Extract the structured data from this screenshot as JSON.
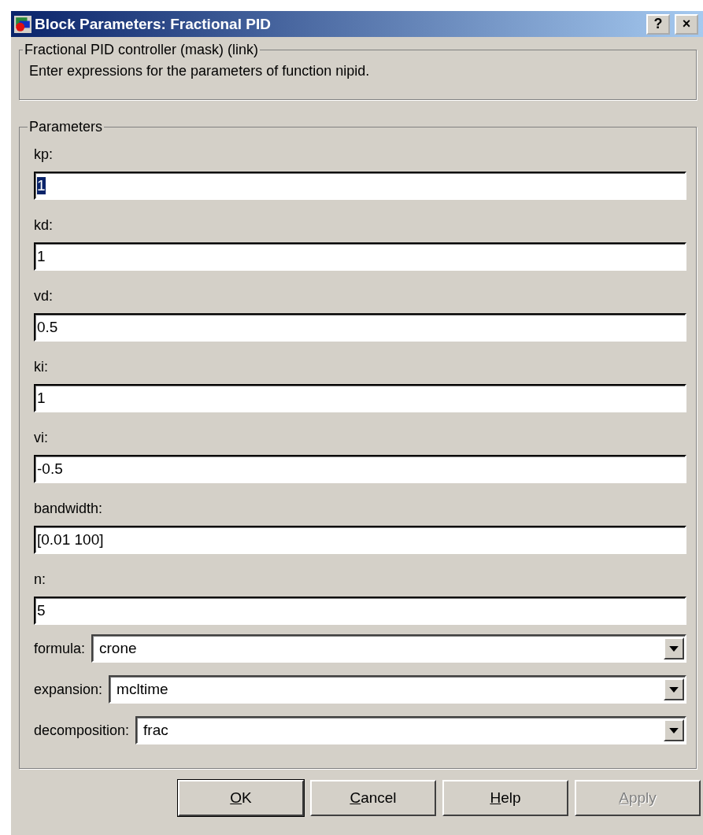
{
  "window": {
    "title": "Block Parameters: Fractional PID",
    "help_button": "?",
    "close_button": "×"
  },
  "description": {
    "legend": "Fractional PID controller (mask) (link)",
    "text": "Enter expressions for the parameters of function nipid."
  },
  "parameters": {
    "legend": "Parameters",
    "fields": [
      {
        "label": "kp:",
        "value": "1",
        "selected": true
      },
      {
        "label": "kd:",
        "value": "1",
        "selected": false
      },
      {
        "label": "vd:",
        "value": "0.5",
        "selected": false
      },
      {
        "label": "ki:",
        "value": "1",
        "selected": false
      },
      {
        "label": "vi:",
        "value": "-0.5",
        "selected": false
      },
      {
        "label": "bandwidth:",
        "value": "[0.01 100]",
        "selected": false
      },
      {
        "label": "n:",
        "value": "5",
        "selected": false
      }
    ],
    "dropdowns": [
      {
        "label": "formula:",
        "value": "crone"
      },
      {
        "label": "expansion:",
        "value": "mcltime"
      },
      {
        "label": "decomposition:",
        "value": "frac"
      }
    ]
  },
  "buttons": [
    {
      "label": "OK",
      "default": true,
      "disabled": false
    },
    {
      "label": "Cancel",
      "default": false,
      "disabled": false
    },
    {
      "label": "Help",
      "default": false,
      "disabled": false
    },
    {
      "label": "Apply",
      "default": false,
      "disabled": true
    }
  ]
}
